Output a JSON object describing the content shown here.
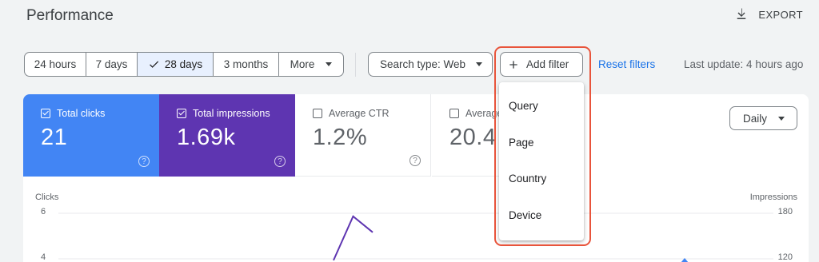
{
  "header": {
    "title": "Performance",
    "export_label": "EXPORT"
  },
  "date_range": {
    "options": [
      {
        "label": "24 hours",
        "selected": false
      },
      {
        "label": "7 days",
        "selected": false
      },
      {
        "label": "28 days",
        "selected": true
      },
      {
        "label": "3 months",
        "selected": false
      },
      {
        "label": "More",
        "selected": false
      }
    ]
  },
  "filters": {
    "search_type_label": "Search type: Web",
    "add_filter_label": "Add filter",
    "reset_label": "Reset filters",
    "last_update": "Last update: 4 hours ago"
  },
  "filter_menu": {
    "items": [
      "Query",
      "Page",
      "Country",
      "Device"
    ]
  },
  "metrics": [
    {
      "label": "Total clicks",
      "value": "21",
      "checked": true,
      "color": "#4285f4"
    },
    {
      "label": "Total impressions",
      "value": "1.69k",
      "checked": true,
      "color": "#5e35b1"
    },
    {
      "label": "Average CTR",
      "value": "1.2%",
      "checked": false
    },
    {
      "label": "Average position",
      "value": "20.4",
      "checked": false
    }
  ],
  "granularity": {
    "label": "Daily"
  },
  "chart_data": {
    "type": "line",
    "ylabel_left": "Clicks",
    "ylabel_right": "Impressions",
    "left_ticks": [
      "6",
      "4"
    ],
    "right_ticks": [
      "180",
      "120"
    ],
    "series": [
      {
        "name": "Impressions",
        "color": "#5e35b1",
        "partial_points": [
          [
            0.0,
            118
          ],
          [
            0.5,
            176
          ],
          [
            1.0,
            155
          ]
        ]
      }
    ]
  }
}
